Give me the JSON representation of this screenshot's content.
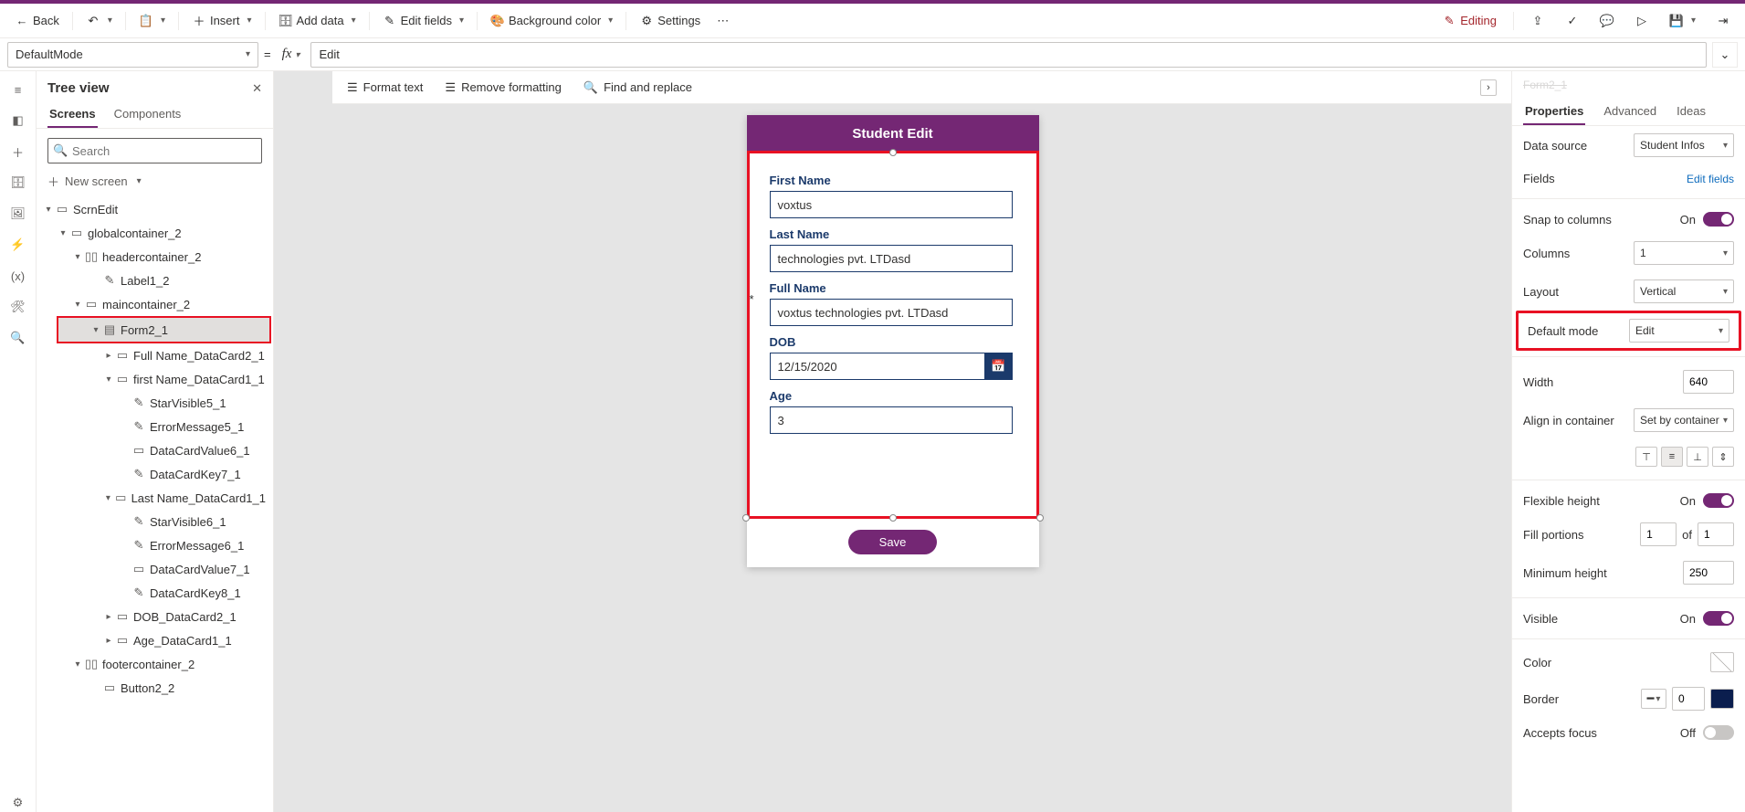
{
  "topbar": {
    "back": "Back",
    "insert": "Insert",
    "adddata": "Add data",
    "editfields": "Edit fields",
    "bgcolor": "Background color",
    "settings": "Settings",
    "editing": "Editing"
  },
  "formula": {
    "property": "DefaultMode",
    "value": "Edit"
  },
  "canvasToolbar": {
    "formatText": "Format text",
    "removeFormatting": "Remove formatting",
    "findReplace": "Find and replace"
  },
  "tree": {
    "title": "Tree view",
    "tabScreens": "Screens",
    "tabComponents": "Components",
    "searchPlaceholder": "Search",
    "newScreen": "New screen",
    "nodes": {
      "scrnEdit": "ScrnEdit",
      "globalcontainer": "globalcontainer_2",
      "headercontainer": "headercontainer_2",
      "label1": "Label1_2",
      "maincontainer": "maincontainer_2",
      "form2": "Form2_1",
      "fullnameCard": "Full Name_DataCard2_1",
      "firstnameCard": "first Name_DataCard1_1",
      "starVisible5": "StarVisible5_1",
      "errorMessage5": "ErrorMessage5_1",
      "dataCardValue6": "DataCardValue6_1",
      "dataCardKey7": "DataCardKey7_1",
      "lastnameCard": "Last Name_DataCard1_1",
      "starVisible6": "StarVisible6_1",
      "errorMessage6": "ErrorMessage6_1",
      "dataCardValue7": "DataCardValue7_1",
      "dataCardKey8": "DataCardKey8_1",
      "dobCard": "DOB_DataCard2_1",
      "ageCard": "Age_DataCard1_1",
      "footercontainer": "footercontainer_2",
      "button2": "Button2_2"
    }
  },
  "phone": {
    "header": "Student Edit",
    "fields": {
      "firstNameLabel": "First Name",
      "firstNameValue": "voxtus",
      "lastNameLabel": "Last Name",
      "lastNameValue": "technologies pvt. LTDasd",
      "fullNameLabel": "Full Name",
      "fullNameValue": "voxtus technologies pvt. LTDasd",
      "dobLabel": "DOB",
      "dobValue": "12/15/2020",
      "ageLabel": "Age",
      "ageValue": "3"
    },
    "save": "Save"
  },
  "props": {
    "crumb": "Form2_1",
    "tabProperties": "Properties",
    "tabAdvanced": "Advanced",
    "tabIdeas": "Ideas",
    "dataSourceLabel": "Data source",
    "dataSourceValue": "Student Infos",
    "fieldsLabel": "Fields",
    "editFieldsLink": "Edit fields",
    "snapLabel": "Snap to columns",
    "snapOn": "On",
    "columnsLabel": "Columns",
    "columnsValue": "1",
    "layoutLabel": "Layout",
    "layoutValue": "Vertical",
    "defaultModeLabel": "Default mode",
    "defaultModeValue": "Edit",
    "widthLabel": "Width",
    "widthValue": "640",
    "alignLabel": "Align in container",
    "alignValue": "Set by container",
    "flexHeightLabel": "Flexible height",
    "flexHeightOn": "On",
    "fillPortionsLabel": "Fill portions",
    "fillPortionsValue": "1",
    "fillPortionsOf": "of",
    "fillPortionsTotal": "1",
    "minHeightLabel": "Minimum height",
    "minHeightValue": "250",
    "visibleLabel": "Visible",
    "visibleOn": "On",
    "colorLabel": "Color",
    "borderLabel": "Border",
    "borderValue": "0",
    "acceptsFocusLabel": "Accepts focus",
    "acceptsFocusOff": "Off"
  }
}
